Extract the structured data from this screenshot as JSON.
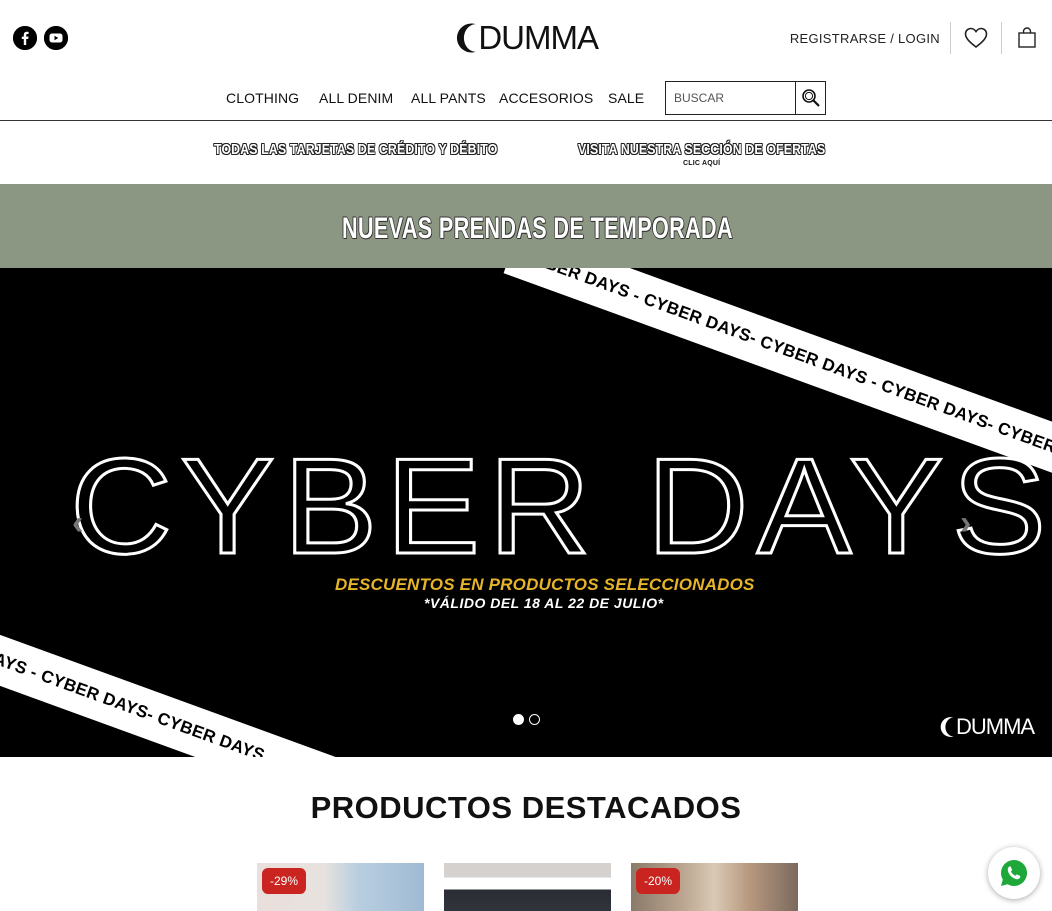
{
  "header": {
    "social": [
      {
        "icon": "facebook-icon"
      },
      {
        "icon": "youtube-icon"
      }
    ],
    "logo_text": "DUMMA",
    "login_label": "REGISTRARSE / LOGIN",
    "wishlist_icon": "heart-icon",
    "cart_icon": "shopping-bag-icon"
  },
  "nav": {
    "items": [
      {
        "label": "CLOTHING"
      },
      {
        "label": "ALL DENIM"
      },
      {
        "label": "ALL PANTS"
      },
      {
        "label": "ACCESORIOS"
      },
      {
        "label": "SALE"
      }
    ],
    "search_placeholder": "BUSCAR",
    "search_icon": "search-icon"
  },
  "promo": {
    "cards_text": "TODAS LAS TARJETAS DE CRÉDITO Y DÉBITO",
    "offers_text": "VISITA NUESTRA SECCIÓN DE OFERTAS",
    "offers_sub": "CLIC AQUÍ"
  },
  "season_banner": "NUEVAS PRENDAS DE TEMPORADA",
  "hero": {
    "ribbon_top": "CYBER DAYS - CYBER DAYS- CYBER DAYS - CYBER DAYS- CYBER DAYS",
    "ribbon_bottom": "BER DAYS - CYBER DAYS- CYBER DAYS - CYBER DAYS",
    "headline": "CYBER DAYS",
    "discount_text": "DESCUENTOS EN PRODUCTOS SELECCIONADOS",
    "valid_text": "*VÁLIDO DEL 18 AL 22 DE JULIO*",
    "prev_arrow": "‹",
    "next_arrow": "›",
    "slides_total": 2,
    "active_slide": 1,
    "logo_text": "DUMMA"
  },
  "featured": {
    "title": "PRODUCTOS DESTACADOS",
    "products": [
      {
        "badge": "-29%"
      },
      {
        "badge": ""
      },
      {
        "badge": "-20%"
      }
    ]
  },
  "whatsapp_icon": "whatsapp-icon",
  "colors": {
    "season_bg": "#8b9783",
    "discount_text": "#e5b428",
    "badge_bg": "#c9241f",
    "whatsapp": "#1fa83a"
  }
}
